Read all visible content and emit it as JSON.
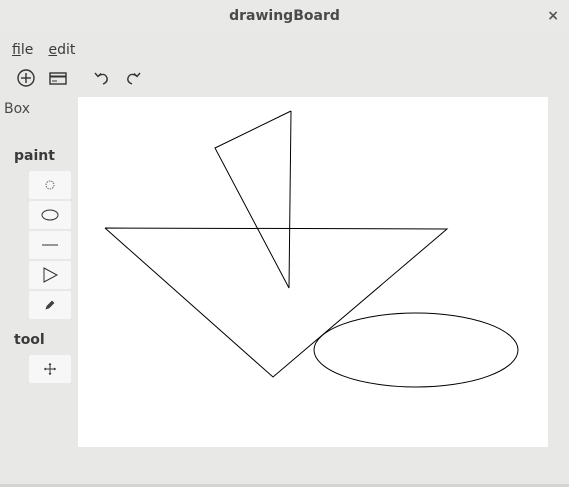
{
  "window": {
    "title": "drawingBoard",
    "close_glyph": "×"
  },
  "menubar": {
    "file": {
      "mnemonic": "f",
      "rest": "ile"
    },
    "edit": {
      "mnemonic": "e",
      "rest": "dit"
    }
  },
  "toolbar": {
    "icons": [
      "add-circle-icon",
      "card-icon",
      "undo-icon",
      "redo-icon"
    ]
  },
  "sidebar": {
    "box_label": "Box",
    "paint_label": "paint",
    "paint_tools": [
      "lasso-icon",
      "ellipse-icon",
      "line-icon",
      "triangle-icon",
      "pencil-icon"
    ],
    "tool_label": "tool",
    "tool_tools": [
      "move-icon"
    ]
  }
}
